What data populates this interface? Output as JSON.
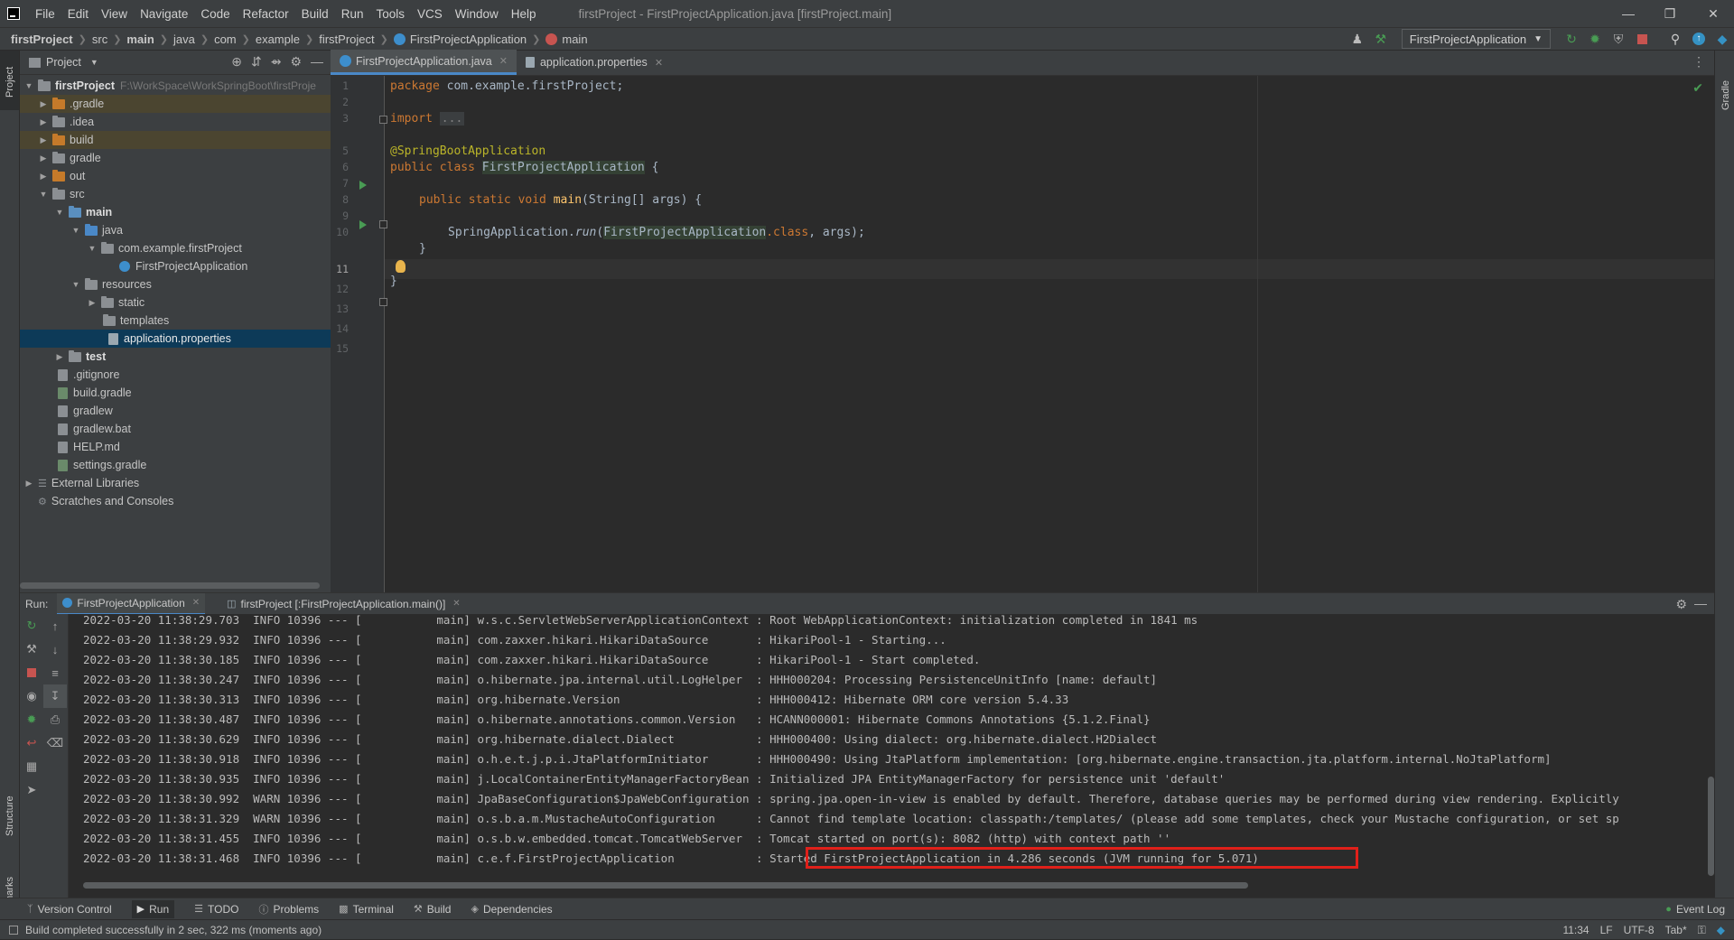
{
  "window": {
    "title": "firstProject - FirstProjectApplication.java [firstProject.main]",
    "menu": [
      "File",
      "Edit",
      "View",
      "Navigate",
      "Code",
      "Refactor",
      "Build",
      "Run",
      "Tools",
      "VCS",
      "Window",
      "Help"
    ]
  },
  "breadcrumb": [
    "firstProject",
    "src",
    "main",
    "java",
    "com",
    "example",
    "firstProject",
    "FirstProjectApplication",
    "main"
  ],
  "toolbar": {
    "run_config": "FirstProjectApplication"
  },
  "project_panel": {
    "title": "Project",
    "tree": [
      {
        "label": "firstProject",
        "extra": "F:\\WorkSpace\\WorkSpringBoot\\firstProje"
      },
      {
        "label": ".gradle"
      },
      {
        "label": ".idea"
      },
      {
        "label": "build"
      },
      {
        "label": "gradle"
      },
      {
        "label": "out"
      },
      {
        "label": "src"
      },
      {
        "label": "main"
      },
      {
        "label": "java"
      },
      {
        "label": "com.example.firstProject"
      },
      {
        "label": "FirstProjectApplication"
      },
      {
        "label": "resources"
      },
      {
        "label": "static"
      },
      {
        "label": "templates"
      },
      {
        "label": "application.properties"
      },
      {
        "label": "test"
      },
      {
        "label": ".gitignore"
      },
      {
        "label": "build.gradle"
      },
      {
        "label": "gradlew"
      },
      {
        "label": "gradlew.bat"
      },
      {
        "label": "HELP.md"
      },
      {
        "label": "settings.gradle"
      },
      {
        "label": "External Libraries"
      },
      {
        "label": "Scratches and Consoles"
      }
    ]
  },
  "editor": {
    "tabs": [
      "FirstProjectApplication.java",
      "application.properties"
    ],
    "line_numbers": [
      "1",
      "2",
      "3",
      "5",
      "6",
      "7",
      "8",
      "9",
      "10",
      "11",
      "12",
      "13",
      "14",
      "15"
    ],
    "code": {
      "pkg_kw": "package",
      "pkg_name": " com.example.firstProject;",
      "imp_kw": "import",
      "imp_fold": "...",
      "annotation": "@SpringBootApplication",
      "cls_kw": "public class ",
      "cls_name": "FirstProjectApplication",
      "cls_brace": " {",
      "main_kw": "public static void ",
      "main_name": "main",
      "main_sig": "(String[] args) {",
      "run_a": "SpringApplication.",
      "run_b": "run",
      "run_c": "(",
      "run_d": "FirstProjectApplication",
      "run_e": ".class",
      ", args": ", args);",
      "run_f": ", args);",
      "close1": "}",
      "close2": "}"
    }
  },
  "run_panel": {
    "label": "Run:",
    "tabs": [
      "FirstProjectApplication",
      "firstProject [:FirstProjectApplication.main()]"
    ],
    "logs": [
      "2022-03-20 11:38:29.703  INFO 10396 --- [           main] w.s.c.ServletWebServerApplicationContext : Root WebApplicationContext: initialization completed in 1841 ms",
      "2022-03-20 11:38:29.932  INFO 10396 --- [           main] com.zaxxer.hikari.HikariDataSource       : HikariPool-1 - Starting...",
      "2022-03-20 11:38:30.185  INFO 10396 --- [           main] com.zaxxer.hikari.HikariDataSource       : HikariPool-1 - Start completed.",
      "2022-03-20 11:38:30.247  INFO 10396 --- [           main] o.hibernate.jpa.internal.util.LogHelper  : HHH000204: Processing PersistenceUnitInfo [name: default]",
      "2022-03-20 11:38:30.313  INFO 10396 --- [           main] org.hibernate.Version                    : HHH000412: Hibernate ORM core version 5.4.33",
      "2022-03-20 11:38:30.487  INFO 10396 --- [           main] o.hibernate.annotations.common.Version   : HCANN000001: Hibernate Commons Annotations {5.1.2.Final}",
      "2022-03-20 11:38:30.629  INFO 10396 --- [           main] org.hibernate.dialect.Dialect            : HHH000400: Using dialect: org.hibernate.dialect.H2Dialect",
      "2022-03-20 11:38:30.918  INFO 10396 --- [           main] o.h.e.t.j.p.i.JtaPlatformInitiator       : HHH000490: Using JtaPlatform implementation: [org.hibernate.engine.transaction.jta.platform.internal.NoJtaPlatform]",
      "2022-03-20 11:38:30.935  INFO 10396 --- [           main] j.LocalContainerEntityManagerFactoryBean : Initialized JPA EntityManagerFactory for persistence unit 'default'",
      "2022-03-20 11:38:30.992  WARN 10396 --- [           main] JpaBaseConfiguration$JpaWebConfiguration : spring.jpa.open-in-view is enabled by default. Therefore, database queries may be performed during view rendering. Explicitly",
      "2022-03-20 11:38:31.329  WARN 10396 --- [           main] o.s.b.a.m.MustacheAutoConfiguration      : Cannot find template location: classpath:/templates/ (please add some templates, check your Mustache configuration, or set sp",
      "2022-03-20 11:38:31.455  INFO 10396 --- [           main] o.s.b.w.embedded.tomcat.TomcatWebServer  : Tomcat started on port(s): 8082 (http) with context path ''",
      "2022-03-20 11:38:31.468  INFO 10396 --- [           main] c.e.f.FirstProjectApplication            : Started FirstProjectApplication in 4.286 seconds (JVM running for 5.071)"
    ]
  },
  "bottom_tabs": [
    "Version Control",
    "Run",
    "TODO",
    "Problems",
    "Terminal",
    "Build",
    "Dependencies"
  ],
  "event_log": "Event Log",
  "status": {
    "message": "Build completed successfully in 2 sec, 322 ms (moments ago)",
    "position": "11:34",
    "line_sep": "LF",
    "encoding": "UTF-8",
    "indent": "Tab*"
  },
  "side_labels": {
    "project": "Project",
    "structure": "Structure",
    "bookmarks": "Bookmarks",
    "gradle": "Gradle"
  },
  "colors": {
    "accent": "#4a88c7",
    "highlight_box": "#e0201a",
    "run_green": "#499c54"
  }
}
